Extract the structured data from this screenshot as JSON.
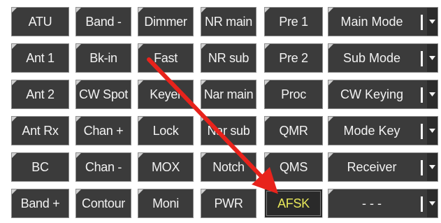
{
  "grid": {
    "columns": [
      [
        "ATU",
        "Ant 1",
        "Ant 2",
        "Ant Rx",
        "BC",
        "Band +"
      ],
      [
        "Band -",
        "Bk-in",
        "CW Spot",
        "Chan +",
        "Chan -",
        "Contour"
      ],
      [
        "Dimmer",
        "Fast",
        "Keyer",
        "Lock",
        "MOX",
        "Moni"
      ],
      [
        "NR main",
        "NR sub",
        "Nar main",
        "Nar sub",
        "Notch",
        "PWR"
      ],
      [
        "Pre 1",
        "Pre 2",
        "Proc",
        "QMR",
        "QMS",
        "AFSK"
      ]
    ],
    "active_button": "AFSK",
    "combos": [
      "Main Mode",
      "Sub Mode",
      "CW Keying",
      "Mode Key",
      "Receiver",
      "- - -"
    ]
  },
  "annotation": {
    "arrow_color": "#e8231c"
  },
  "colors": {
    "button_bg": "#3b3b3b",
    "button_text": "#f2f2f2",
    "active_text": "#e8e85a"
  }
}
